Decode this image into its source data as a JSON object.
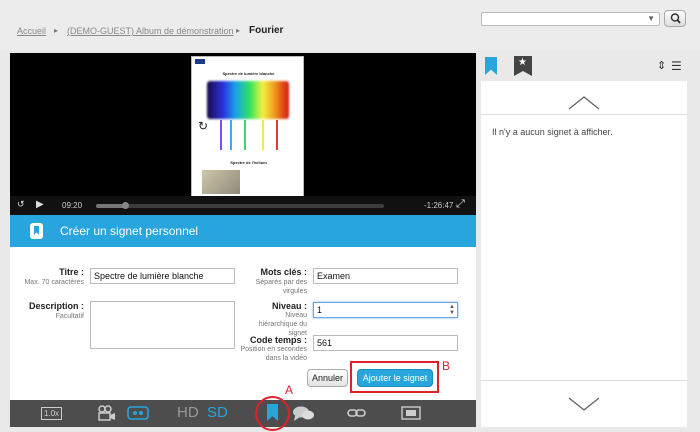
{
  "breadcrumb": {
    "home": "Accueil",
    "album": "(DEMO-GUEST) Album de démonstration",
    "current": "Fourier"
  },
  "player": {
    "slide_title_1": "Spectre de lumière blanche",
    "slide_title_2": "Spectre de l'hélium",
    "slide_logo": "ULB",
    "time_current": "09:20",
    "time_remaining": "-1:26:47",
    "progress_fraction": 0.1
  },
  "form": {
    "header": "Créer un signet personnel",
    "title_label": "Titre :",
    "title_hint": "Max. 70 caractères",
    "title_value": "Spectre de lumière blanche",
    "description_label": "Description :",
    "description_hint": "Facultatif",
    "description_value": "",
    "keywords_label": "Mots clés :",
    "keywords_hint": "Séparés par des virgules",
    "keywords_value": "Examen",
    "level_label": "Niveau :",
    "level_hint": "Niveau hiérarchique du signet",
    "level_value": "1",
    "timecode_label": "Code temps :",
    "timecode_hint": "Position en secondes dans la vidéo",
    "timecode_value": "561",
    "cancel_button": "Annuler",
    "add_button": "Ajouter le signet"
  },
  "toolbar": {
    "speed": "1.0x",
    "hd": "HD",
    "sd": "SD"
  },
  "annotations": {
    "a": "A",
    "b": "B"
  },
  "side": {
    "empty_message": "Il n'y a aucun signet à afficher."
  },
  "colors": {
    "accent": "#27a5dc",
    "annotation_red": "#e0212b"
  }
}
